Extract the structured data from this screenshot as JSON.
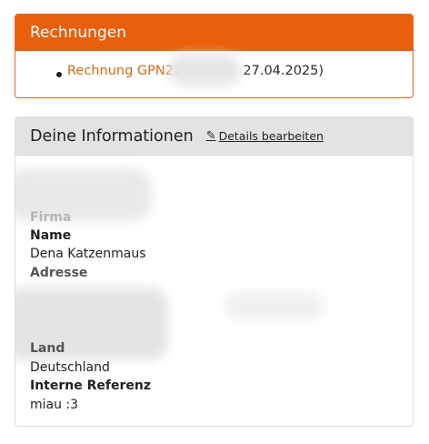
{
  "invoices": {
    "title": "Rechnungen",
    "items": [
      {
        "link_label": "Rechnung GPN23",
        "date_suffix": "27.04.2025)"
      }
    ]
  },
  "info": {
    "title": "Deine Informationen",
    "edit_icon": "edit-icon",
    "edit_label": "Details bearbeiten",
    "fields": {
      "firma_label": "Firma",
      "name_label": "Name",
      "name_value": "Dena Katzenmaus",
      "adresse_label": "Adresse",
      "land_label": "Land",
      "land_value": "Deutschland",
      "ref_label": "Interne Referenz",
      "ref_value": "miau :3"
    }
  },
  "colors": {
    "accent": "#ea5f0b",
    "link": "#cf6b14",
    "header_bg": "#e3e3e3"
  }
}
